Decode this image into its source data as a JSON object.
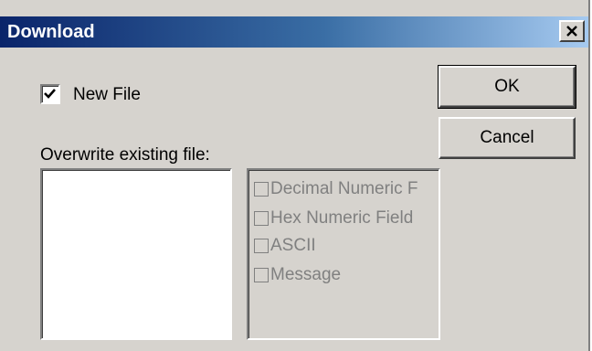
{
  "window": {
    "title": "Download"
  },
  "new_file": {
    "label": "New File",
    "checked": true
  },
  "overwrite": {
    "label": "Overwrite existing file:",
    "files": []
  },
  "buttons": {
    "ok": "OK",
    "cancel": "Cancel"
  },
  "types": {
    "items": [
      {
        "label": "Decimal Numeric F",
        "checked": false
      },
      {
        "label": "Hex Numeric Field",
        "checked": false
      },
      {
        "label": "ASCII",
        "checked": false
      },
      {
        "label": "Message",
        "checked": false
      }
    ]
  },
  "colors": {
    "dialog_face": "#d6d3ce",
    "titlebar_start": "#0a246a",
    "titlebar_end": "#a6caf0",
    "disabled_text": "#808080"
  }
}
